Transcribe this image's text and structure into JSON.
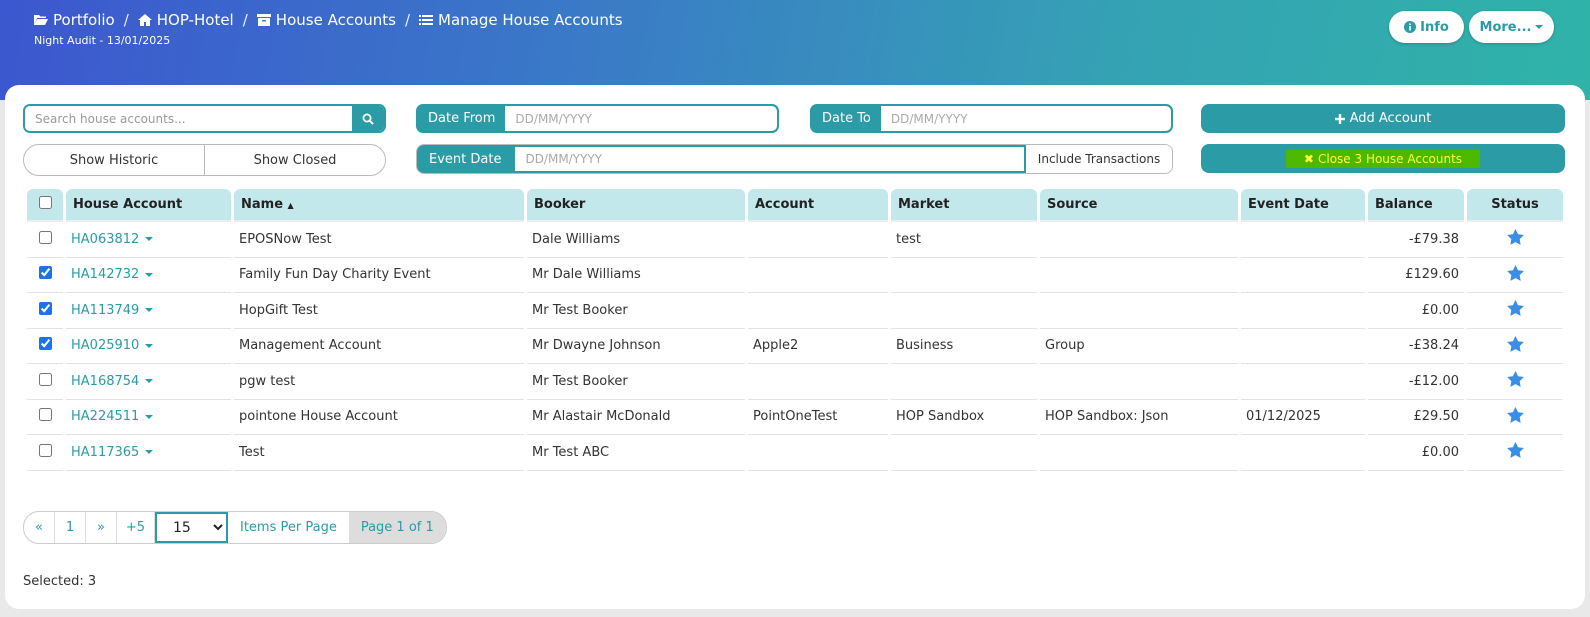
{
  "breadcrumb": {
    "items": [
      {
        "label": "Portfolio",
        "icon": "folder-open-icon"
      },
      {
        "label": "HOP-Hotel",
        "icon": "home-icon"
      },
      {
        "label": "House Accounts",
        "icon": "archive-icon"
      },
      {
        "label": "Manage House Accounts",
        "icon": "list-icon"
      }
    ],
    "separator": "/"
  },
  "night_audit": "Night Audit - 13/01/2025",
  "header_buttons": {
    "info_label": "Info",
    "more_label": "More..."
  },
  "search": {
    "placeholder": "Search house accounts..."
  },
  "toggles": {
    "historic": "Show Historic",
    "closed": "Show Closed"
  },
  "date_from": {
    "label": "Date From",
    "placeholder": "DD/MM/YYYY"
  },
  "date_to": {
    "label": "Date To",
    "placeholder": "DD/MM/YYYY"
  },
  "event_date_filter": {
    "label": "Event Date",
    "placeholder": "DD/MM/YYYY",
    "include_label": "Include Transactions"
  },
  "actions": {
    "add_label": "Add Account",
    "close_label": "Close 3 House Accounts"
  },
  "colors": {
    "accent": "#2b9ba6",
    "header_start": "#3c57cf",
    "header_end": "#2fb3a8",
    "star": "#3a8ee6",
    "close_highlight_bg": "#4db800",
    "close_highlight_text": "#ffff33"
  },
  "table": {
    "headers": {
      "house_account": "House Account",
      "name": "Name",
      "booker": "Booker",
      "account": "Account",
      "market": "Market",
      "source": "Source",
      "event_date": "Event Date",
      "balance": "Balance",
      "status": "Status"
    },
    "sort_indicator": "▲",
    "rows": [
      {
        "checked": false,
        "house_account": "HA063812",
        "name": "EPOSNow Test",
        "booker": "Dale Williams",
        "account": "",
        "market": "test",
        "source": "",
        "event_date": "",
        "balance": "-£79.38",
        "status_icon": "star-icon"
      },
      {
        "checked": true,
        "house_account": "HA142732",
        "name": "Family Fun Day Charity Event",
        "booker": "Mr Dale Williams",
        "account": "",
        "market": "",
        "source": "",
        "event_date": "",
        "balance": "£129.60",
        "status_icon": "star-icon"
      },
      {
        "checked": true,
        "house_account": "HA113749",
        "name": "HopGift Test",
        "booker": "Mr Test Booker",
        "account": "",
        "market": "",
        "source": "",
        "event_date": "",
        "balance": "£0.00",
        "status_icon": "star-icon"
      },
      {
        "checked": true,
        "house_account": "HA025910",
        "name": "Management Account",
        "booker": "Mr Dwayne Johnson",
        "account": "Apple2",
        "market": "Business",
        "source": "Group",
        "event_date": "",
        "balance": "-£38.24",
        "status_icon": "star-icon"
      },
      {
        "checked": false,
        "house_account": "HA168754",
        "name": "pgw test",
        "booker": "Mr Test Booker",
        "account": "",
        "market": "",
        "source": "",
        "event_date": "",
        "balance": "-£12.00",
        "status_icon": "star-icon"
      },
      {
        "checked": false,
        "house_account": "HA224511",
        "name": "pointone House Account",
        "booker": "Mr Alastair McDonald",
        "account": "PointOneTest",
        "market": "HOP Sandbox",
        "source": "HOP Sandbox: Json",
        "event_date": "01/12/2025",
        "balance": "£29.50",
        "status_icon": "star-icon"
      },
      {
        "checked": false,
        "house_account": "HA117365",
        "name": "Test",
        "booker": "Mr Test ABC",
        "account": "",
        "market": "",
        "source": "",
        "event_date": "",
        "balance": "£0.00",
        "status_icon": "star-icon"
      }
    ]
  },
  "pager": {
    "first": "«",
    "page": "1",
    "next": "»",
    "jump": "+5",
    "per_page_value": "15",
    "per_page_options": [
      "15"
    ],
    "items_per_page": "Items Per Page",
    "page_of": "Page 1 of 1"
  },
  "selected": "Selected: 3"
}
